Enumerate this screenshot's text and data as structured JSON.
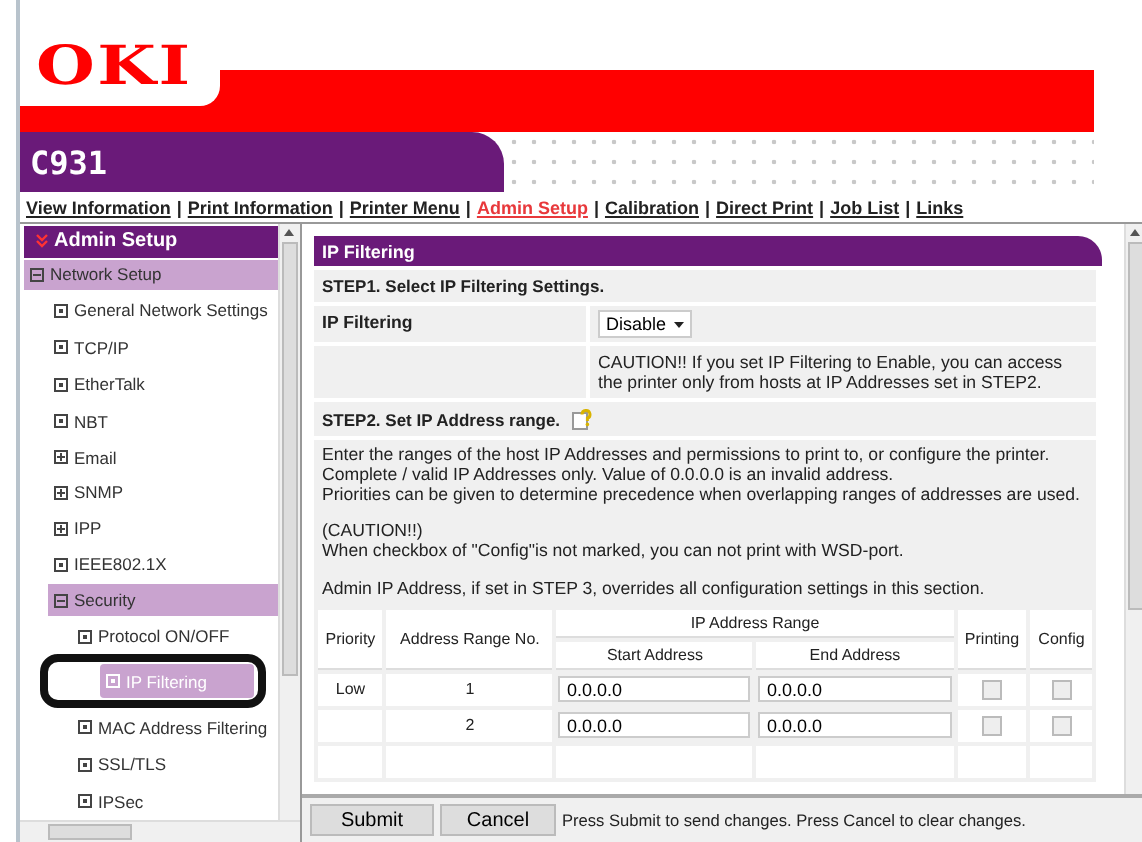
{
  "logo": "OKI",
  "model": "C931",
  "nav": {
    "separator": "|",
    "links": [
      {
        "label": "View Information",
        "selected": false
      },
      {
        "label": "Print Information",
        "selected": false
      },
      {
        "label": "Printer Menu",
        "selected": false
      },
      {
        "label": "Admin Setup",
        "selected": true
      },
      {
        "label": "Calibration",
        "selected": false
      },
      {
        "label": "Direct Print",
        "selected": false
      },
      {
        "label": "Job List",
        "selected": false
      },
      {
        "label": "Links",
        "selected": false
      }
    ]
  },
  "sidebar": {
    "title": "Admin Setup",
    "items": [
      {
        "label": "Network Setup",
        "kind": "group",
        "expanded": true,
        "selected": false,
        "children": [
          {
            "label": "General Network Settings",
            "kind": "leaf",
            "selected": false
          },
          {
            "label": "TCP/IP",
            "kind": "leaf",
            "selected": false
          },
          {
            "label": "EtherTalk",
            "kind": "leaf",
            "selected": false
          },
          {
            "label": "NBT",
            "kind": "leaf",
            "selected": false
          },
          {
            "label": "Email",
            "kind": "group",
            "expanded": false,
            "selected": false
          },
          {
            "label": "SNMP",
            "kind": "group",
            "expanded": false,
            "selected": false
          },
          {
            "label": "IPP",
            "kind": "group",
            "expanded": false,
            "selected": false
          },
          {
            "label": "IEEE802.1X",
            "kind": "leaf",
            "selected": false
          },
          {
            "label": "Security",
            "kind": "group",
            "expanded": true,
            "selected": false,
            "children": [
              {
                "label": "Protocol ON/OFF",
                "kind": "leaf",
                "selected": false
              },
              {
                "label": "IP Filtering",
                "kind": "leaf",
                "selected": true,
                "circled": true
              },
              {
                "label": "MAC Address Filtering",
                "kind": "leaf",
                "selected": false
              },
              {
                "label": "SSL/TLS",
                "kind": "leaf",
                "selected": false
              },
              {
                "label": "IPSec",
                "kind": "leaf",
                "selected": false
              }
            ]
          }
        ]
      }
    ]
  },
  "panel": {
    "title": "IP Filtering",
    "step1": {
      "title": "STEP1.  Select IP Filtering Settings.",
      "label": "IP Filtering",
      "value": "Disable",
      "caution": "CAUTION!! If you set IP Filtering to Enable, you can access the printer only from hosts at IP Addresses set in STEP2."
    },
    "step2": {
      "title": "STEP2.  Set IP Address range.",
      "paragraphs": [
        [
          "Enter the ranges of the host IP Addresses and permissions to print to, or configure the printer.",
          "Complete / valid IP Addresses only. Value of 0.0.0.0 is an invalid address.",
          "Priorities can be given to determine precedence when overlapping ranges of addresses are used."
        ],
        [
          "(CAUTION!!)",
          "When checkbox of \"Config\"is not marked, you can not print with WSD-port."
        ],
        [
          "Admin IP Address, if set in STEP 3, overrides all configuration settings in this section."
        ]
      ]
    },
    "table": {
      "columns": [
        "Priority",
        "Address Range No.",
        "IP Address Range",
        "Printing",
        "Config"
      ],
      "subcolumns": [
        "Start Address",
        "End Address"
      ],
      "rows": [
        {
          "priority": "Low",
          "no": "1",
          "start": "0.0.0.0",
          "end": "0.0.0.0",
          "printing": false,
          "config": false
        },
        {
          "priority": "",
          "no": "2",
          "start": "0.0.0.0",
          "end": "0.0.0.0",
          "printing": false,
          "config": false
        }
      ]
    }
  },
  "footer": {
    "buttons": [
      "Submit",
      "Cancel"
    ],
    "hint": "Press Submit to send changes. Press Cancel to clear changes."
  }
}
